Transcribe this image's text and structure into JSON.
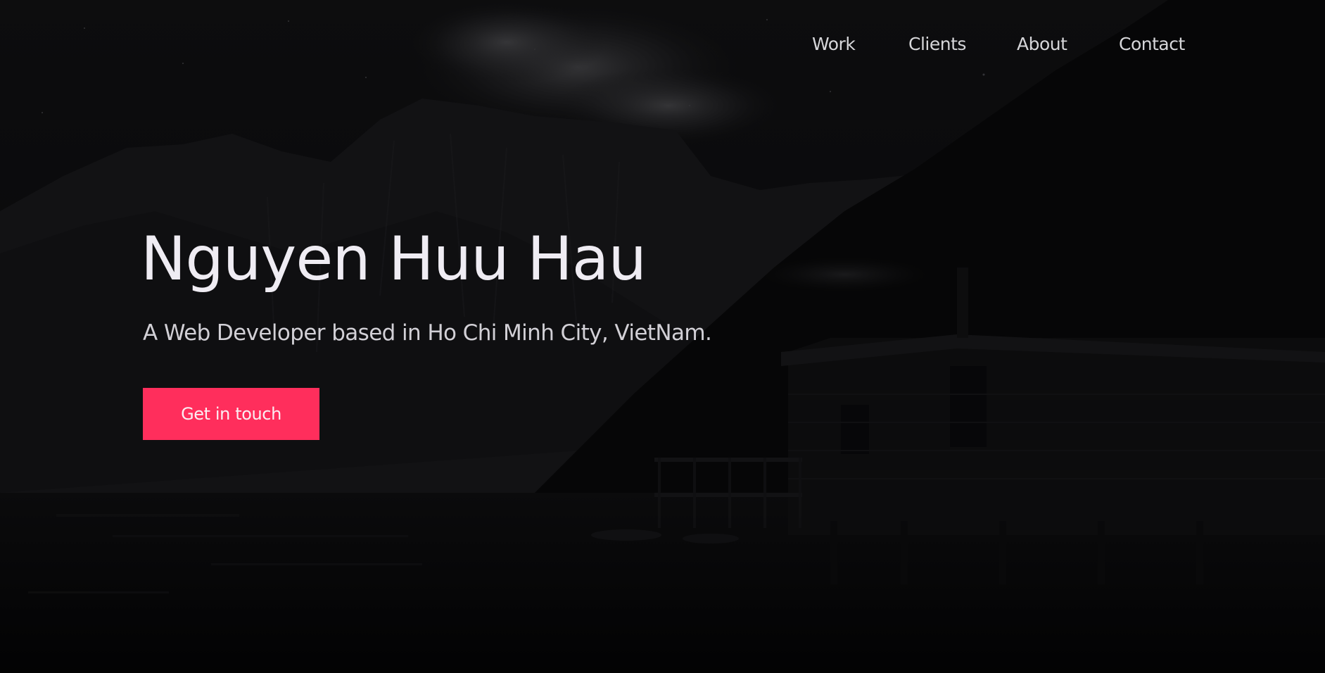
{
  "nav": {
    "items": [
      {
        "label": "Work"
      },
      {
        "label": "Clients"
      },
      {
        "label": "About"
      },
      {
        "label": "Contact"
      }
    ]
  },
  "hero": {
    "title": "Nguyen Huu Hau",
    "subtitle": "A Web Developer based in Ho Chi Minh City, VietNam.",
    "cta_label": "Get in touch"
  },
  "colors": {
    "background": "#070708",
    "accent": "#ff2e5c",
    "text_primary": "#efecf3",
    "text_secondary": "#d2d0d6"
  }
}
